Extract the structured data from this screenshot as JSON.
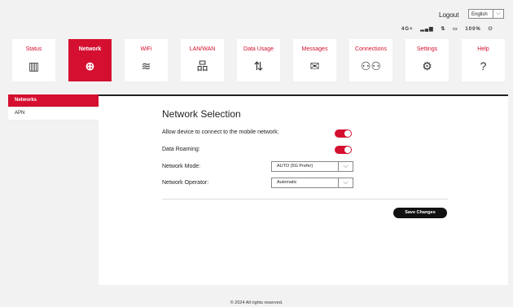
{
  "header": {
    "logout_label": "Logout",
    "language": "English",
    "status_items": [
      "4G+",
      "signal",
      "arrows",
      "battery",
      "100%",
      "user"
    ]
  },
  "nav": [
    {
      "label": "Status",
      "icon": "status-icon"
    },
    {
      "label": "Network",
      "icon": "globe-icon"
    },
    {
      "label": "WiFi",
      "icon": "wifi-icon"
    },
    {
      "label": "LAN/WAN",
      "icon": "lan-icon"
    },
    {
      "label": "Data Usage",
      "icon": "data-usage-icon"
    },
    {
      "label": "Messages",
      "icon": "envelope-icon"
    },
    {
      "label": "Connections",
      "icon": "people-icon"
    },
    {
      "label": "Settings",
      "icon": "gear-icon"
    },
    {
      "label": "Help",
      "icon": "help-icon"
    }
  ],
  "sidebar": {
    "items": [
      {
        "label": "Networks"
      },
      {
        "label": "APN"
      }
    ]
  },
  "main": {
    "title": "Network Selection",
    "allow_label": "Allow device to connect to the mobile network:",
    "roaming_label": "Data Roaming:",
    "mode_label": "Network Mode:",
    "mode_value": "AUTO (5G Prefer)",
    "operator_label": "Network Operator:",
    "operator_value": "Automatic",
    "save_label": "Save Changes"
  },
  "footer": {
    "copyright": "© 2024 All rights reserved."
  },
  "colors": {
    "accent": "#d40f2f",
    "background": "#f2f2f2"
  }
}
